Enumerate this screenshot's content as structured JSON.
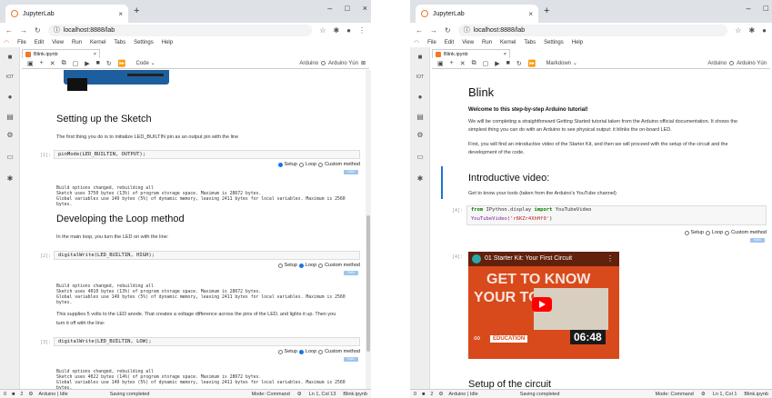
{
  "browser": {
    "tab_title": "JupyterLab",
    "tab_close": "×",
    "new_tab": "+",
    "url": "localhost:8888/lab",
    "min": "–",
    "max": "□",
    "close": "×"
  },
  "menu": [
    "File",
    "Edit",
    "View",
    "Run",
    "Kernel",
    "Tabs",
    "Settings",
    "Help"
  ],
  "sidebar_label": "IOT",
  "left": {
    "doc_tab": "Blink.ipynb",
    "cell_type": "Code",
    "kernel": "Arduino",
    "kernel_status": "Arduino Yún",
    "h_setup": "Setting up the Sketch",
    "p_setup": "The first thing you do is to initialize LED_BUILTIN pin as an output pin with the line",
    "c1_prompt": "[1]:",
    "c1_code": "pinMode(LED_BUILTIN, OUTPUT);",
    "o1": "Build options changed, rebuilding all\nSketch uses 3750 bytes (13%) of program storage space. Maximum is 28672 bytes.\nGlobal variables use 149 bytes (5%) of dynamic memory, leaving 2411 bytes for local variables. Maximum is 2560\nbytes.",
    "h_loop": "Developing the Loop method",
    "p_loop": "In the main loop, you turn the LED on with the line:",
    "c2_prompt": "[2]:",
    "c2_code": "digitalWrite(LED_BUILTIN, HIGH);",
    "o2": "Build options changed, rebuilding all\nSketch uses 4010 bytes (13%) of program storage space. Maximum is 28672 bytes.\nGlobal variables use 149 bytes (5%) of dynamic memory, leaving 2411 bytes for local variables. Maximum is 2560\nbytes.",
    "p_supply1": "This supplies 5 volts to the LED anode. That creates a voltage difference across the pins of the LED, and lights it up. Then you",
    "p_supply2": "turn it off with the line:",
    "c3_prompt": "[3]:",
    "c3_code": "digitalWrite(LED_BUILTIN, LOW);",
    "o3": "Build options changed, rebuilding all\nSketch uses 4022 bytes (14%) of program storage space. Maximum is 28672 bytes.\nGlobal variables use 149 bytes (5%) of dynamic memory, leaving 2411 bytes for local variables. Maximum is 2560\nbytes.",
    "status_mode": "Mode: Command",
    "status_pos": "Ln 1, Col 13",
    "status_file": "Blink.ipynb"
  },
  "right": {
    "doc_tab": "Blink.ipynb",
    "cell_type": "Markdown",
    "kernel": "Arduino",
    "kernel_status": "Arduino Yún",
    "h_blink": "Blink",
    "welcome": "Welcome to this step-by-step Arduino tutorial!",
    "p_welcome1": "We will be completing a straightforward Getting Started tutorial taken from the Arduino official documentation. It shows the",
    "p_welcome2": "simplest thing you can do with an Arduino to see physical output: it blinks the on-board LED.",
    "p_first1": "First, you will find an introductive video of the Starter Kit, and then we will proceed with the setup of the circuit and the",
    "p_first2": "development of the code.",
    "h_video": "Introductive video:",
    "p_video": "Get to know your tools (taken from the Arduino's YouTube channel)",
    "c4_prompt": "[4]:",
    "c4_kw1": "from",
    "c4_mod": " IPython.display ",
    "c4_kw2": "import",
    "c4_cls": " YouTubeVideo",
    "c4_line2_fn": "YouTubeVideo(",
    "c4_line2_str": "'r6KZr4XhHf0'",
    "c4_line2_end": ")",
    "o4_prompt": "[4]:",
    "video_title": "01 Starter Kit: Your First Circuit",
    "video_get": "GET TO KNOW",
    "video_tools": "YOUR TOOLS",
    "video_badge": "EDUCATION",
    "video_time": "06:48",
    "h_setup": "Setup of the circuit",
    "status_mode": "Mode: Command",
    "status_pos": "Ln 1, Col 1",
    "status_file": "Blink.ipynb"
  },
  "radio": {
    "setup": "Setup",
    "loop": "Loop",
    "custom": "Custom method",
    "run": "RUN"
  },
  "status": {
    "left": "0",
    "terms": "2",
    "kernel": "Arduino | Idle",
    "saving": "Saving completed"
  }
}
